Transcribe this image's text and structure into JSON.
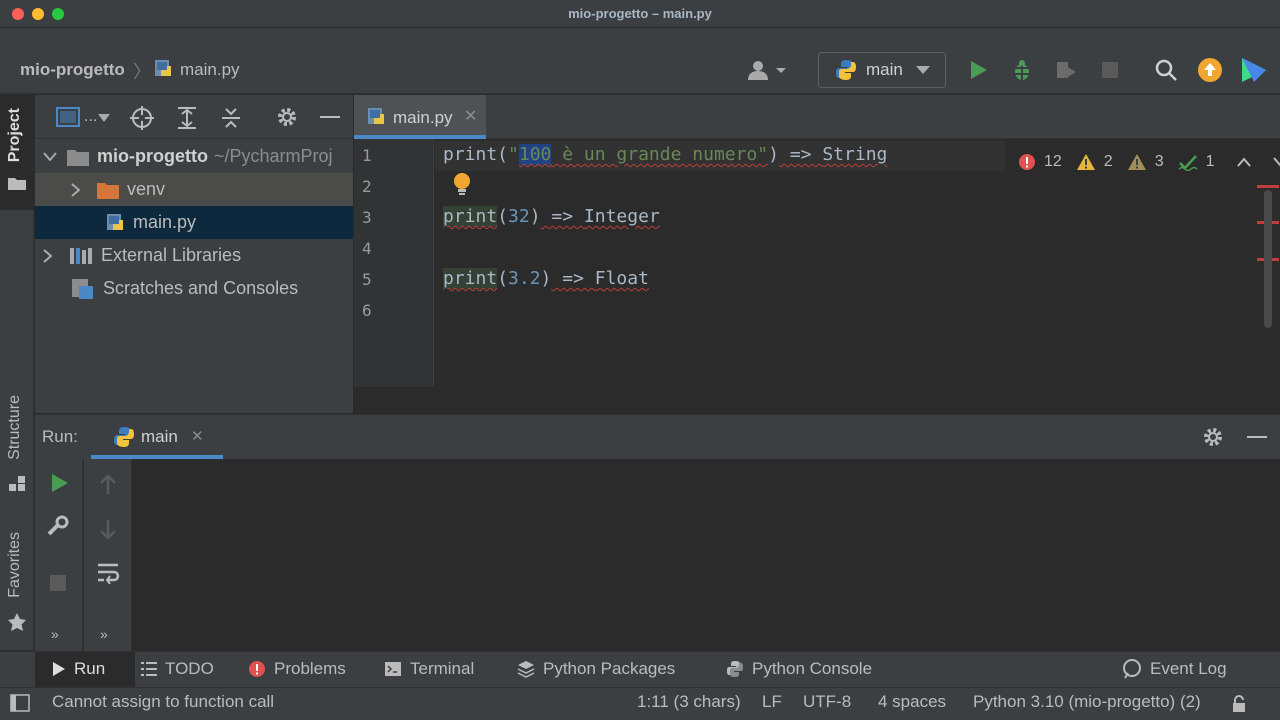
{
  "window": {
    "title": "mio-progetto – main.py"
  },
  "navbar": {
    "project": "mio-progetto",
    "file": "main.py",
    "run_config": "main"
  },
  "left_strip": {
    "project_tab": "Project",
    "structure_tab": "Structure",
    "favorites_tab": "Favorites"
  },
  "project_tree": {
    "toolbar_label": "...",
    "root_name": "mio-progetto",
    "root_path": "~/PycharmProj",
    "venv": "venv",
    "main": "main.py",
    "external_libraries": "External Libraries",
    "scratches": "Scratches and Consoles"
  },
  "editor": {
    "tab_label": "main.py",
    "line_numbers": [
      "1",
      "2",
      "3",
      "4",
      "5",
      "6"
    ],
    "line1": {
      "fn": "print(",
      "quote_open": "\"",
      "sel": "100",
      "rest": " è un grande numero\"",
      "close": ")",
      "arrow": " => ",
      "type": "String"
    },
    "line3": {
      "fn": "print",
      "paren": "(",
      "num": "32",
      "close": ")",
      "arrow": " => ",
      "type": "Integer"
    },
    "line5": {
      "fn": "print",
      "paren": "(",
      "num": "3.2",
      "close": ")",
      "arrow": " => ",
      "type": "Float"
    },
    "inspections": {
      "errors": "12",
      "warnings": "2",
      "weak_warnings": "3",
      "typos": "1"
    }
  },
  "run_panel": {
    "label": "Run:",
    "tab": "main"
  },
  "bottom_tools": {
    "run": "Run",
    "todo": "TODO",
    "problems": "Problems",
    "terminal": "Terminal",
    "python_packages": "Python Packages",
    "python_console": "Python Console",
    "event_log": "Event Log"
  },
  "status_bar": {
    "message": "Cannot assign to function call",
    "position": "1:11 (3 chars)",
    "line_sep": "LF",
    "encoding": "UTF-8",
    "indent": "4 spaces",
    "interpreter": "Python 3.10 (mio-progetto) (2)"
  },
  "colors": {
    "accent": "#4a88c7",
    "run_green": "#499c54",
    "error_red": "#e05252",
    "warning_yellow": "#e8b63a",
    "update_orange": "#f0a732"
  }
}
